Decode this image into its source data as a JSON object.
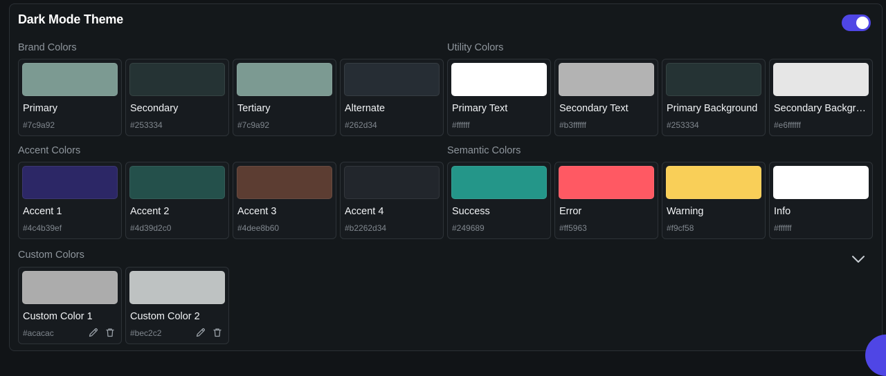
{
  "header": {
    "title": "Dark Mode Theme",
    "toggle_on": true,
    "toggle_color": "#4f46e5"
  },
  "sections": {
    "brand": {
      "label": "Brand Colors",
      "items": [
        {
          "name": "Primary",
          "hex": "#7c9a92",
          "color": "#7c9a92"
        },
        {
          "name": "Secondary",
          "hex": "#253334",
          "color": "#253334"
        },
        {
          "name": "Tertiary",
          "hex": "#7c9a92",
          "color": "#7c9a92"
        },
        {
          "name": "Alternate",
          "hex": "#262d34",
          "color": "#262d34"
        }
      ]
    },
    "utility": {
      "label": "Utility Colors",
      "items": [
        {
          "name": "Primary Text",
          "hex": "#ffffff",
          "color": "#ffffff"
        },
        {
          "name": "Secondary Text",
          "hex": "#b3ffffff",
          "color": "#b3b3b3"
        },
        {
          "name": "Primary Background",
          "hex": "#253334",
          "color": "#253334"
        },
        {
          "name": "Secondary Background",
          "hex": "#e6ffffff",
          "color": "#e6e6e6"
        }
      ]
    },
    "accent": {
      "label": "Accent Colors",
      "items": [
        {
          "name": "Accent 1",
          "hex": "#4c4b39ef",
          "color": "#2c2766"
        },
        {
          "name": "Accent 2",
          "hex": "#4d39d2c0",
          "color": "#24504b"
        },
        {
          "name": "Accent 3",
          "hex": "#4dee8b60",
          "color": "#5c3d32"
        },
        {
          "name": "Accent 4",
          "hex": "#b2262d34",
          "color": "#22262c"
        }
      ]
    },
    "semantic": {
      "label": "Semantic Colors",
      "items": [
        {
          "name": "Success",
          "hex": "#249689",
          "color": "#249689"
        },
        {
          "name": "Error",
          "hex": "#ff5963",
          "color": "#ff5963"
        },
        {
          "name": "Warning",
          "hex": "#f9cf58",
          "color": "#f9cf58"
        },
        {
          "name": "Info",
          "hex": "#ffffff",
          "color": "#ffffff"
        }
      ]
    },
    "custom": {
      "label": "Custom Colors",
      "items": [
        {
          "name": "Custom Color 1",
          "hex": "#acacac",
          "color": "#acacac"
        },
        {
          "name": "Custom Color 2",
          "hex": "#bec2c2",
          "color": "#bec2c2"
        }
      ]
    }
  },
  "icons": {
    "edit": "pencil-icon",
    "delete": "trash-icon",
    "expand": "chevron-down-icon"
  }
}
